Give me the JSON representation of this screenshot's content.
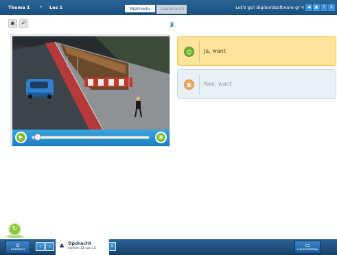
{
  "header": {
    "breadcrumb": [
      "Thema 1",
      "Les 1"
    ],
    "breadcrumb_separator": "›",
    "tabs": [
      {
        "label": "Methode",
        "active": true
      },
      {
        "label": "Leerkracht",
        "active": false
      }
    ],
    "product_title": "Let's go! digibordsoftware gr 4",
    "window_buttons": [
      {
        "icon": "back-icon",
        "glyph": "◀",
        "color": "#3b8fd8"
      },
      {
        "icon": "display-icon",
        "glyph": "▣",
        "color": "#3b8fd8"
      },
      {
        "icon": "info-icon",
        "glyph": "?",
        "color": "#3b8fd8"
      },
      {
        "icon": "close-icon",
        "glyph": "✕",
        "color": "#3b8fd8"
      }
    ]
  },
  "toolbar": {
    "settings_glyph": "✱",
    "undo_glyph": "↶"
  },
  "question": {
    "number": "3"
  },
  "video": {
    "play_glyph": "▶",
    "fullscreen_glyph": "▣",
    "progress": 0.0
  },
  "answers": [
    {
      "badge": "☺",
      "label": "Ja, want",
      "selected": true
    },
    {
      "badge": "B",
      "label": "Nee, want",
      "selected": false
    }
  ],
  "refresh_glyph": "↻",
  "footer": {
    "lesmenu_label": "Lesmenu",
    "lesmenu_glyph": "⌂",
    "prev_glyph": "‹",
    "next_glyph": "›",
    "task_title": "Opdracht",
    "task_subtitle": "scherm 11 van 13",
    "expand_glyph": "»",
    "gereedschap_label": "Gereedschap",
    "gereedschap_glyph": "▭"
  },
  "colors": {
    "bar_blue": "#1a4f7e",
    "answer_selected": "#ffe39a",
    "answer_default": "#e9f1f7",
    "green": "#7fbf2f"
  }
}
